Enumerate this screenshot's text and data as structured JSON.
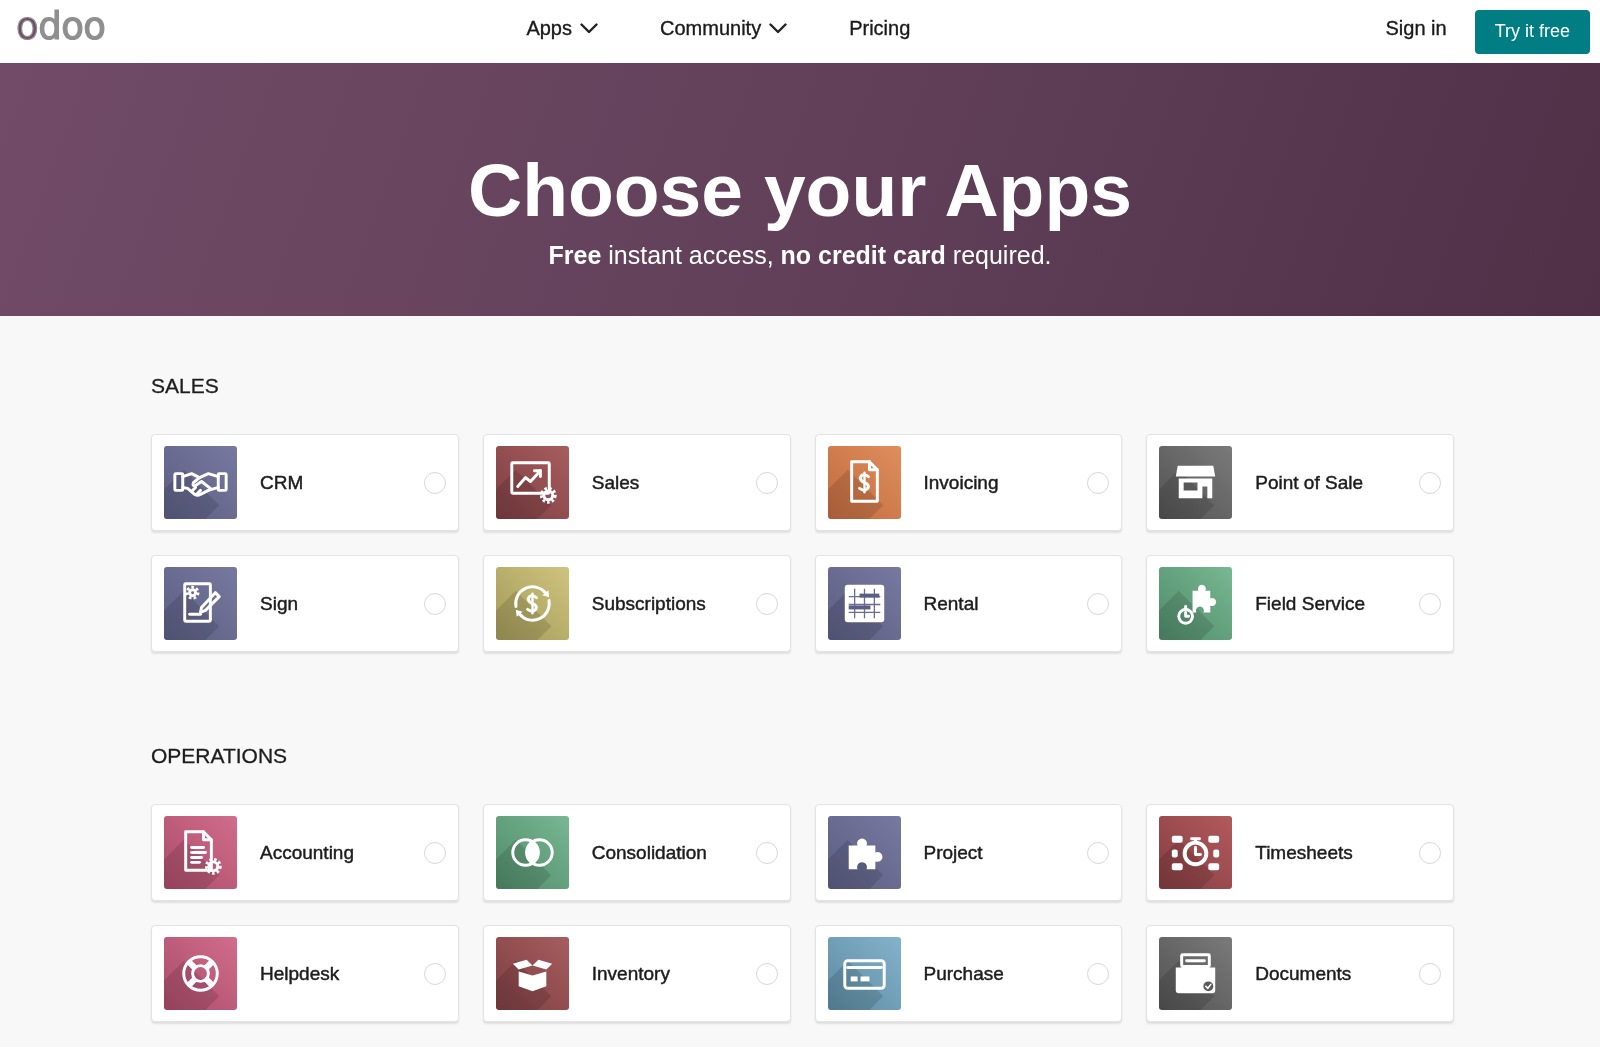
{
  "header": {
    "logo": "odoo",
    "nav": [
      {
        "label": "Apps",
        "dropdown": true
      },
      {
        "label": "Community",
        "dropdown": true
      },
      {
        "label": "Pricing",
        "dropdown": false
      }
    ],
    "sign_in": "Sign in",
    "cta": "Try it free"
  },
  "hero": {
    "title": "Choose your Apps",
    "subtitle": "**Free** instant access, **no credit card** required."
  },
  "sections": [
    {
      "title": "SALES",
      "apps": [
        {
          "label": "CRM",
          "selected": false
        },
        {
          "label": "Sales",
          "selected": false
        },
        {
          "label": "Invoicing",
          "selected": false
        },
        {
          "label": "Point of Sale",
          "selected": false
        },
        {
          "label": "Sign",
          "selected": false
        },
        {
          "label": "Subscriptions",
          "selected": false
        },
        {
          "label": "Rental",
          "selected": false
        },
        {
          "label": "Field Service",
          "selected": false
        }
      ]
    },
    {
      "title": "OPERATIONS",
      "apps": [
        {
          "label": "Accounting",
          "selected": false
        },
        {
          "label": "Consolidation",
          "selected": false
        },
        {
          "label": "Project",
          "selected": false
        },
        {
          "label": "Timesheets",
          "selected": false
        },
        {
          "label": "Helpdesk",
          "selected": false
        },
        {
          "label": "Inventory",
          "selected": false
        },
        {
          "label": "Purchase",
          "selected": false
        },
        {
          "label": "Documents",
          "selected": false
        }
      ]
    }
  ]
}
